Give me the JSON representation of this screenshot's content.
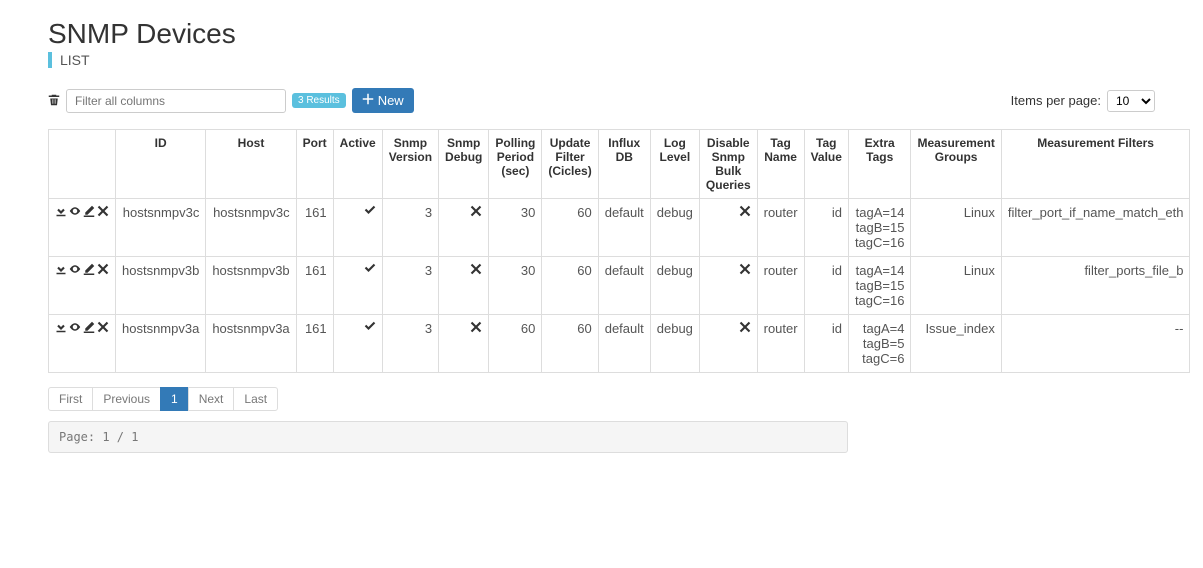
{
  "header": {
    "title": "SNMP Devices",
    "subtitle": "LIST"
  },
  "toolbar": {
    "filter_placeholder": "Filter all columns",
    "results_badge": "3 Results",
    "new_label": "New",
    "items_label": "Items per page:",
    "items_value": "10"
  },
  "columns": {
    "actions": "",
    "id": "ID",
    "host": "Host",
    "port": "Port",
    "active": "Active",
    "snmp_version": "Snmp Version",
    "snmp_debug": "Snmp Debug",
    "polling": "Polling Period (sec)",
    "update_filter": "Update Filter (Cicles)",
    "influx": "Influx DB",
    "log": "Log Level",
    "disable_bulk": "Disable Snmp Bulk Queries",
    "tag_name": "Tag Name",
    "tag_value": "Tag Value",
    "extra_tags": "Extra Tags",
    "meas_groups": "Measurement Groups",
    "meas_filters": "Measurement Filters"
  },
  "rows": [
    {
      "id": "hostsnmpv3c",
      "host": "hostsnmpv3c",
      "port": "161",
      "active": true,
      "snmp_version": "3",
      "snmp_debug": false,
      "polling": "30",
      "update_filter": "60",
      "influx": "default",
      "log": "debug",
      "disable_bulk": false,
      "tag_name": "router",
      "tag_value": "id",
      "extra_tags": [
        "tagA=14",
        "tagB=15",
        "tagC=16"
      ],
      "meas_groups": "Linux",
      "meas_filters": "filter_port_if_name_match_eth"
    },
    {
      "id": "hostsnmpv3b",
      "host": "hostsnmpv3b",
      "port": "161",
      "active": true,
      "snmp_version": "3",
      "snmp_debug": false,
      "polling": "30",
      "update_filter": "60",
      "influx": "default",
      "log": "debug",
      "disable_bulk": false,
      "tag_name": "router",
      "tag_value": "id",
      "extra_tags": [
        "tagA=14",
        "tagB=15",
        "tagC=16"
      ],
      "meas_groups": "Linux",
      "meas_filters": "filter_ports_file_b"
    },
    {
      "id": "hostsnmpv3a",
      "host": "hostsnmpv3a",
      "port": "161",
      "active": true,
      "snmp_version": "3",
      "snmp_debug": false,
      "polling": "60",
      "update_filter": "60",
      "influx": "default",
      "log": "debug",
      "disable_bulk": false,
      "tag_name": "router",
      "tag_value": "id",
      "extra_tags": [
        "tagA=4",
        "tagB=5",
        "tagC=6"
      ],
      "meas_groups": "Issue_index",
      "meas_filters": "--"
    }
  ],
  "pagination": {
    "first": "First",
    "previous": "Previous",
    "page1": "1",
    "next": "Next",
    "last": "Last",
    "status": "Page: 1 / 1"
  }
}
